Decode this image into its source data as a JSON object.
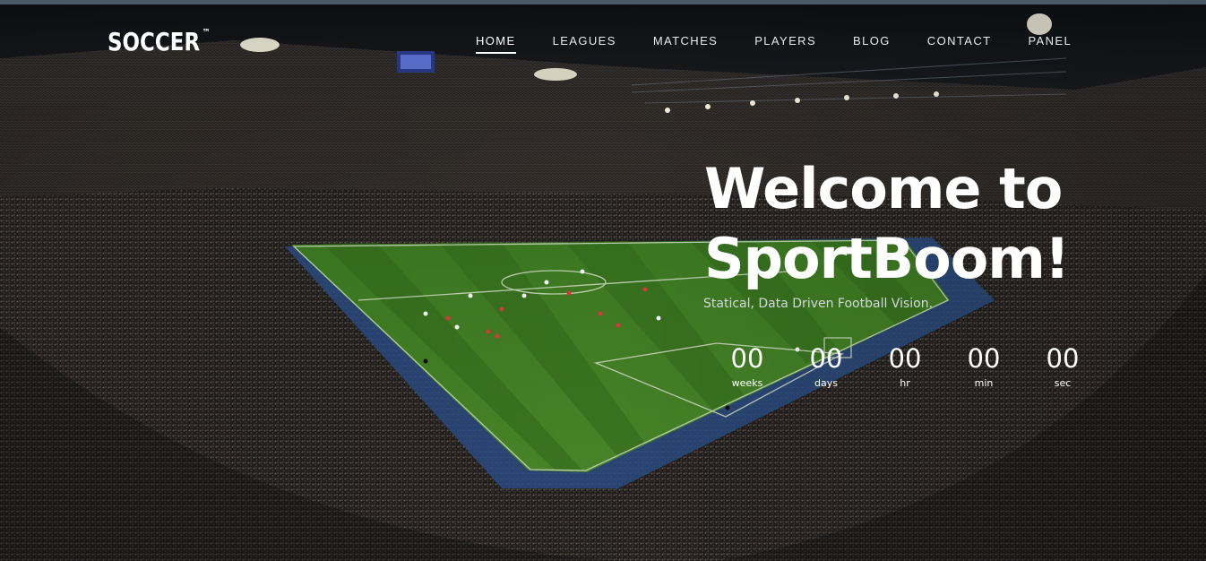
{
  "brand": {
    "logo_text": "SOCCER",
    "trademark": "™"
  },
  "nav": {
    "items": [
      {
        "label": "HOME",
        "active": true
      },
      {
        "label": "LEAGUES",
        "active": false
      },
      {
        "label": "MATCHES",
        "active": false
      },
      {
        "label": "PLAYERS",
        "active": false
      },
      {
        "label": "BLOG",
        "active": false
      },
      {
        "label": "CONTACT",
        "active": false
      },
      {
        "label": "PANEL",
        "active": false
      }
    ]
  },
  "hero": {
    "title_line1": "Welcome to",
    "title_line2": "SportBoom!",
    "subtitle": "Statical, Data Driven Football Vision."
  },
  "countdown": [
    {
      "value": "00",
      "label": "weeks"
    },
    {
      "value": "00",
      "label": "days"
    },
    {
      "value": "00",
      "label": "hr"
    },
    {
      "value": "00",
      "label": "min"
    },
    {
      "value": "00",
      "label": "sec"
    }
  ],
  "colors": {
    "pitch": "#3f7a1f",
    "pitch_dark": "#2f6417",
    "stands": "#1a1c22",
    "text": "#ffffff"
  }
}
